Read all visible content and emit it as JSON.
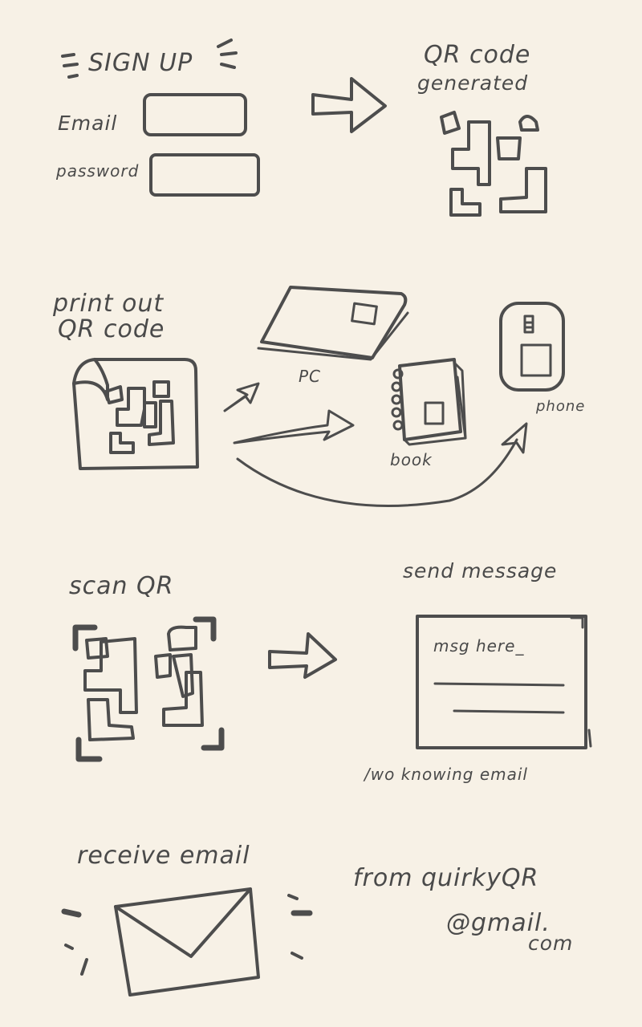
{
  "step1": {
    "title": "SIGN UP",
    "email_label": "Email",
    "password_label": "password"
  },
  "step2": {
    "title_line1": "QR code",
    "title_line2": "generated"
  },
  "step3": {
    "title_line1": "print out",
    "title_line2": "QR code",
    "pc_label": "PC",
    "book_label": "book",
    "phone_label": "phone"
  },
  "step4": {
    "title": "scan QR"
  },
  "step5": {
    "title": "send message",
    "placeholder": "msg here_",
    "note": "/wo knowing email"
  },
  "step6": {
    "title": "receive email",
    "from_line1": "from   quirkyQR",
    "from_line2": "@gmail.",
    "from_line3": "com"
  },
  "colors": {
    "ink": "#4d4d4d",
    "paper": "#f7f1e6"
  }
}
